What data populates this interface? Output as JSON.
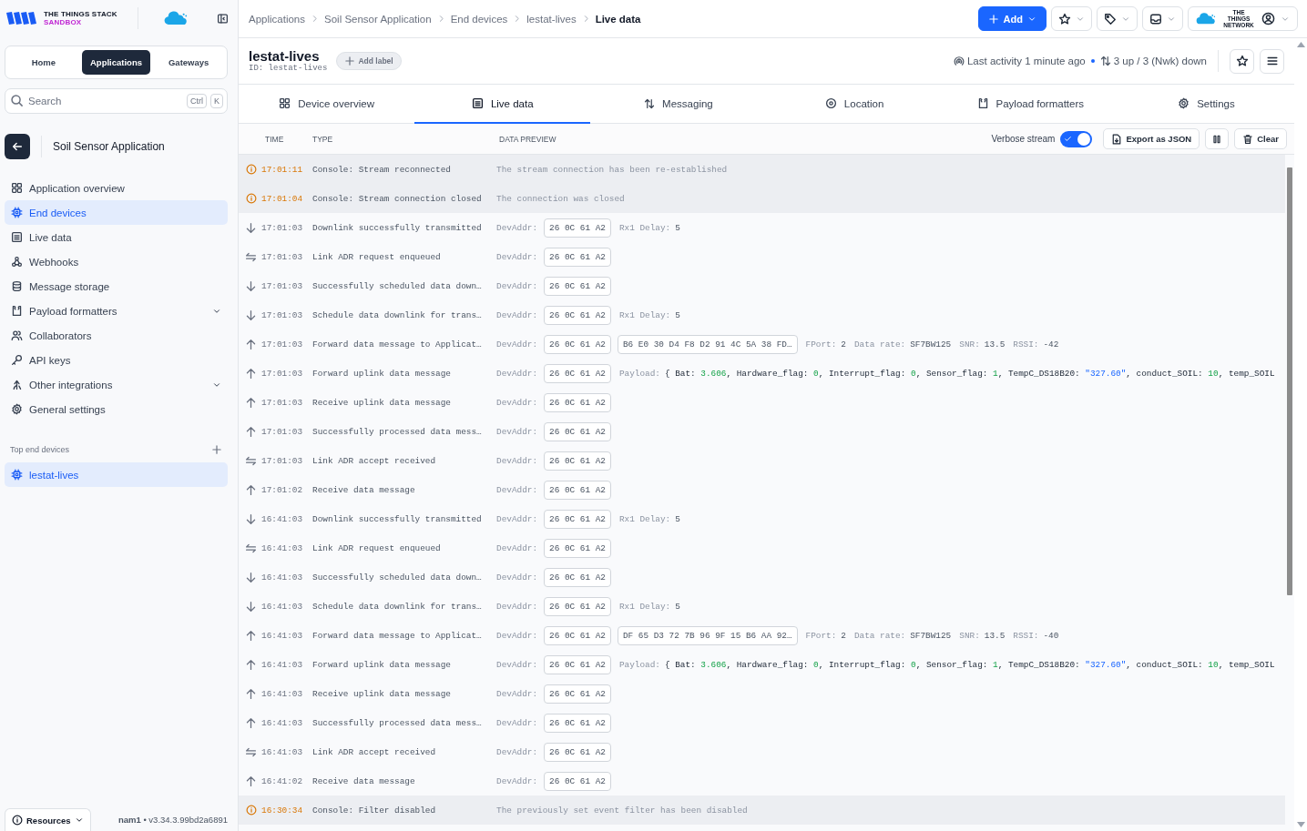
{
  "brand": {
    "title": "THE THINGS STACK",
    "edition": "SANDBOX"
  },
  "top_nav": [
    {
      "label": "Home",
      "selected": false
    },
    {
      "label": "Applications",
      "selected": true
    },
    {
      "label": "Gateways",
      "selected": false
    }
  ],
  "search": {
    "placeholder": "Search",
    "keys": [
      "Ctrl",
      "K"
    ]
  },
  "application": {
    "name": "Soil Sensor Application"
  },
  "sidebar": {
    "items": [
      {
        "label": "Application overview",
        "selected": false,
        "has_submenu": false
      },
      {
        "label": "End devices",
        "selected": true,
        "has_submenu": false
      },
      {
        "label": "Live data",
        "selected": false,
        "has_submenu": false
      },
      {
        "label": "Webhooks",
        "selected": false,
        "has_submenu": false
      },
      {
        "label": "Message storage",
        "selected": false,
        "has_submenu": false
      },
      {
        "label": "Payload formatters",
        "selected": false,
        "has_submenu": true
      },
      {
        "label": "Collaborators",
        "selected": false,
        "has_submenu": false
      },
      {
        "label": "API keys",
        "selected": false,
        "has_submenu": false
      },
      {
        "label": "Other integrations",
        "selected": false,
        "has_submenu": true
      },
      {
        "label": "General settings",
        "selected": false,
        "has_submenu": false
      }
    ],
    "section_title": "Top end devices",
    "devices": [
      {
        "label": "lestat-lives",
        "selected": true
      }
    ],
    "resources": "Resources",
    "version": "**nam1** • v3.34.3.99bd2a6891"
  },
  "breadcrumbs": [
    "Applications",
    "Soil Sensor Application",
    "End devices",
    "lestat-lives",
    "Live data"
  ],
  "toolbar": {
    "add": "Add",
    "account_brand": "THE THINGS NETWORK"
  },
  "device": {
    "name": "lestat-lives",
    "id": "ID: lestat-lives",
    "add_label": "Add label",
    "activity": "Last activity 1 minute ago",
    "frames": "3 up / 3 (Nwk) down"
  },
  "tabs": [
    {
      "label": "Device overview",
      "selected": false
    },
    {
      "label": "Live data",
      "selected": true
    },
    {
      "label": "Messaging",
      "selected": false
    },
    {
      "label": "Location",
      "selected": false
    },
    {
      "label": "Payload formatters",
      "selected": false
    },
    {
      "label": "Settings",
      "selected": false
    }
  ],
  "table": {
    "columns": [
      "TIME",
      "TYPE",
      "DATA PREVIEW"
    ],
    "verbose": {
      "label": "Verbose stream",
      "on": true
    },
    "export": "Export as JSON",
    "clear": "Clear",
    "rows": [
      {
        "kind": "console",
        "time": "17:01:11",
        "type": "Console: Stream reconnected",
        "message": "The stream connection has been re-established"
      },
      {
        "kind": "console",
        "time": "17:01:04",
        "type": "Console: Stream connection closed",
        "message": "The connection was closed"
      },
      {
        "kind": "down",
        "time": "17:01:03",
        "type": "Downlink successfully transmitted",
        "devaddr_label": "DevAddr:",
        "devaddr": "26 0C 61 A2",
        "extras": [
          {
            "kind": "field",
            "label": "Rx1 Delay:",
            "value": "5"
          }
        ]
      },
      {
        "kind": "exchange",
        "time": "17:01:03",
        "type": "Link ADR request enqueued",
        "devaddr_label": "DevAddr:",
        "devaddr": "26 0C 61 A2"
      },
      {
        "kind": "down",
        "time": "17:01:03",
        "type": "Successfully scheduled data down…",
        "devaddr_label": "DevAddr:",
        "devaddr": "26 0C 61 A2"
      },
      {
        "kind": "down",
        "time": "17:01:03",
        "type": "Schedule data downlink for trans…",
        "devaddr_label": "DevAddr:",
        "devaddr": "26 0C 61 A2",
        "extras": [
          {
            "kind": "field",
            "label": "Rx1 Delay:",
            "value": "5"
          }
        ]
      },
      {
        "kind": "up",
        "time": "17:01:03",
        "type": "Forward data message to Applicat…",
        "devaddr_label": "DevAddr:",
        "devaddr": "26 0C 61 A2",
        "extras": [
          {
            "kind": "bytes",
            "value": "B6 E0 30 D4 F8 D2 91 4C 5A 38 FD…"
          },
          {
            "kind": "field",
            "label": "FPort:",
            "value": "2"
          },
          {
            "kind": "field",
            "label": "Data rate:",
            "value": "SF7BW125"
          },
          {
            "kind": "field",
            "label": "SNR:",
            "value": "13.5"
          },
          {
            "kind": "field",
            "label": "RSSI:",
            "value": "-42"
          }
        ]
      },
      {
        "kind": "up",
        "time": "17:01:03",
        "type": "Forward uplink data message",
        "devaddr_label": "DevAddr:",
        "devaddr": "26 0C 61 A2",
        "extras": [
          {
            "kind": "payload",
            "label": "Payload:",
            "segments": [
              {
                "kind": "plain",
                "text": "{ Bat: "
              },
              {
                "kind": "number",
                "text": "3.606"
              },
              {
                "kind": "plain",
                "text": ", Hardware_flag: "
              },
              {
                "kind": "number",
                "text": "0"
              },
              {
                "kind": "plain",
                "text": ", Interrupt_flag: "
              },
              {
                "kind": "number",
                "text": "0"
              },
              {
                "kind": "plain",
                "text": ", Sensor_flag: "
              },
              {
                "kind": "number",
                "text": "1"
              },
              {
                "kind": "plain",
                "text": ", TempC_DS18B20: "
              },
              {
                "kind": "string",
                "text": "\"327.60\""
              },
              {
                "kind": "plain",
                "text": ", conduct_SOIL: "
              },
              {
                "kind": "number",
                "text": "10"
              },
              {
                "kind": "plain",
                "text": ", temp_SOIL"
              }
            ]
          }
        ]
      },
      {
        "kind": "up",
        "time": "17:01:03",
        "type": "Receive uplink data message",
        "devaddr_label": "DevAddr:",
        "devaddr": "26 0C 61 A2"
      },
      {
        "kind": "up",
        "time": "17:01:03",
        "type": "Successfully processed data mess…",
        "devaddr_label": "DevAddr:",
        "devaddr": "26 0C 61 A2"
      },
      {
        "kind": "exchange",
        "time": "17:01:03",
        "type": "Link ADR accept received",
        "devaddr_label": "DevAddr:",
        "devaddr": "26 0C 61 A2"
      },
      {
        "kind": "up",
        "time": "17:01:02",
        "type": "Receive data message",
        "devaddr_label": "DevAddr:",
        "devaddr": "26 0C 61 A2"
      },
      {
        "kind": "down",
        "time": "16:41:03",
        "type": "Downlink successfully transmitted",
        "devaddr_label": "DevAddr:",
        "devaddr": "26 0C 61 A2",
        "extras": [
          {
            "kind": "field",
            "label": "Rx1 Delay:",
            "value": "5"
          }
        ]
      },
      {
        "kind": "exchange",
        "time": "16:41:03",
        "type": "Link ADR request enqueued",
        "devaddr_label": "DevAddr:",
        "devaddr": "26 0C 61 A2"
      },
      {
        "kind": "down",
        "time": "16:41:03",
        "type": "Successfully scheduled data down…",
        "devaddr_label": "DevAddr:",
        "devaddr": "26 0C 61 A2"
      },
      {
        "kind": "down",
        "time": "16:41:03",
        "type": "Schedule data downlink for trans…",
        "devaddr_label": "DevAddr:",
        "devaddr": "26 0C 61 A2",
        "extras": [
          {
            "kind": "field",
            "label": "Rx1 Delay:",
            "value": "5"
          }
        ]
      },
      {
        "kind": "up",
        "time": "16:41:03",
        "type": "Forward data message to Applicat…",
        "devaddr_label": "DevAddr:",
        "devaddr": "26 0C 61 A2",
        "extras": [
          {
            "kind": "bytes",
            "value": "DF 65 D3 72 7B 96 9F 15 B6 AA 92…"
          },
          {
            "kind": "field",
            "label": "FPort:",
            "value": "2"
          },
          {
            "kind": "field",
            "label": "Data rate:",
            "value": "SF7BW125"
          },
          {
            "kind": "field",
            "label": "SNR:",
            "value": "13.5"
          },
          {
            "kind": "field",
            "label": "RSSI:",
            "value": "-40"
          }
        ]
      },
      {
        "kind": "up",
        "time": "16:41:03",
        "type": "Forward uplink data message",
        "devaddr_label": "DevAddr:",
        "devaddr": "26 0C 61 A2",
        "extras": [
          {
            "kind": "payload",
            "label": "Payload:",
            "segments": [
              {
                "kind": "plain",
                "text": "{ Bat: "
              },
              {
                "kind": "number",
                "text": "3.606"
              },
              {
                "kind": "plain",
                "text": ", Hardware_flag: "
              },
              {
                "kind": "number",
                "text": "0"
              },
              {
                "kind": "plain",
                "text": ", Interrupt_flag: "
              },
              {
                "kind": "number",
                "text": "0"
              },
              {
                "kind": "plain",
                "text": ", Sensor_flag: "
              },
              {
                "kind": "number",
                "text": "1"
              },
              {
                "kind": "plain",
                "text": ", TempC_DS18B20: "
              },
              {
                "kind": "string",
                "text": "\"327.60\""
              },
              {
                "kind": "plain",
                "text": ", conduct_SOIL: "
              },
              {
                "kind": "number",
                "text": "10"
              },
              {
                "kind": "plain",
                "text": ", temp_SOIL"
              }
            ]
          }
        ]
      },
      {
        "kind": "up",
        "time": "16:41:03",
        "type": "Receive uplink data message",
        "devaddr_label": "DevAddr:",
        "devaddr": "26 0C 61 A2"
      },
      {
        "kind": "up",
        "time": "16:41:03",
        "type": "Successfully processed data mess…",
        "devaddr_label": "DevAddr:",
        "devaddr": "26 0C 61 A2"
      },
      {
        "kind": "exchange",
        "time": "16:41:03",
        "type": "Link ADR accept received",
        "devaddr_label": "DevAddr:",
        "devaddr": "26 0C 61 A2"
      },
      {
        "kind": "up",
        "time": "16:41:02",
        "type": "Receive data message",
        "devaddr_label": "DevAddr:",
        "devaddr": "26 0C 61 A2"
      },
      {
        "kind": "console",
        "time": "16:30:34",
        "type": "Console: Filter disabled",
        "message": "The previously set event filter has been disabled"
      }
    ]
  }
}
